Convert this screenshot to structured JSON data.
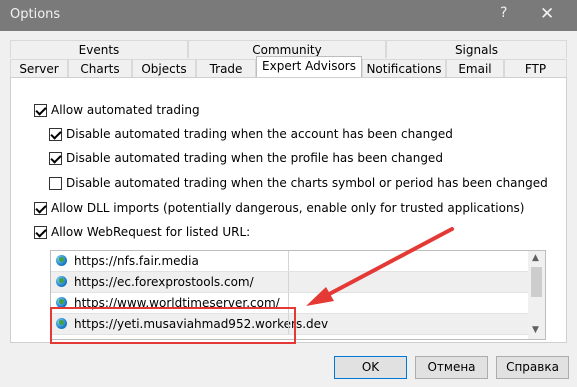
{
  "window": {
    "title": "Options",
    "help_glyph": "?",
    "close_glyph": "✕"
  },
  "tabs_row1": [
    {
      "label": "Events"
    },
    {
      "label": "Community"
    },
    {
      "label": "Signals"
    }
  ],
  "tabs_row2": [
    {
      "label": "Server"
    },
    {
      "label": "Charts"
    },
    {
      "label": "Objects"
    },
    {
      "label": "Trade"
    },
    {
      "label": "Expert Advisors",
      "active": true
    },
    {
      "label": "Notifications"
    },
    {
      "label": "Email"
    },
    {
      "label": "FTP"
    }
  ],
  "options": {
    "allow_automated": {
      "label": "Allow automated trading",
      "checked": true
    },
    "disable_account_change": {
      "label": "Disable automated trading when the account has been changed",
      "checked": true
    },
    "disable_profile_change": {
      "label": "Disable automated trading when the profile has been changed",
      "checked": true
    },
    "disable_symbol_change": {
      "label": "Disable automated trading when the charts symbol or period has been changed",
      "checked": false
    },
    "allow_dll": {
      "label": "Allow DLL imports (potentially dangerous, enable only for trusted applications)",
      "checked": true
    },
    "allow_webrequest": {
      "label": "Allow WebRequest for listed URL:",
      "checked": true
    }
  },
  "urls": [
    "https://nfs.fair.media",
    "https://ec.forexprostools.com/",
    "https://www.worldtimeserver.com/",
    "https://yeti.musaviahmad952.workers.dev"
  ],
  "buttons": {
    "ok": "OK",
    "cancel": "Отмена",
    "help": "Справка"
  },
  "colors": {
    "annotation": "#e53935",
    "titlebar": "#7a7a7a"
  }
}
